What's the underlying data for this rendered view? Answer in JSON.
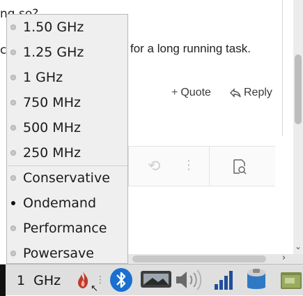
{
  "background": {
    "fragment_top": "ng so?",
    "fragment_left": "co",
    "post_text": "for a long running task.",
    "quote_label": "Quote",
    "reply_label": "Reply"
  },
  "menu": {
    "items": [
      {
        "label": "1.50 GHz",
        "selected": false
      },
      {
        "label": "1.25 GHz",
        "selected": false
      },
      {
        "label": "1 GHz",
        "selected": false
      },
      {
        "label": "750 MHz",
        "selected": false
      },
      {
        "label": "500 MHz",
        "selected": false
      },
      {
        "label": "250 MHz",
        "selected": false
      },
      {
        "label": "Conservative",
        "selected": false
      },
      {
        "label": "Ondemand",
        "selected": true
      },
      {
        "label": "Performance",
        "selected": false
      },
      {
        "label": "Powersave",
        "selected": false
      }
    ]
  },
  "taskbar": {
    "frequency_text": "1 GHz",
    "tray_icons": [
      "cpu-flame-icon",
      "bluetooth-icon",
      "display-icon",
      "volume-icon",
      "network-signal-icon",
      "storage-icon",
      "file-manager-icon"
    ]
  },
  "colors": {
    "bluetooth": "#1a6fd0",
    "cpu_flame": "#c0392b"
  }
}
